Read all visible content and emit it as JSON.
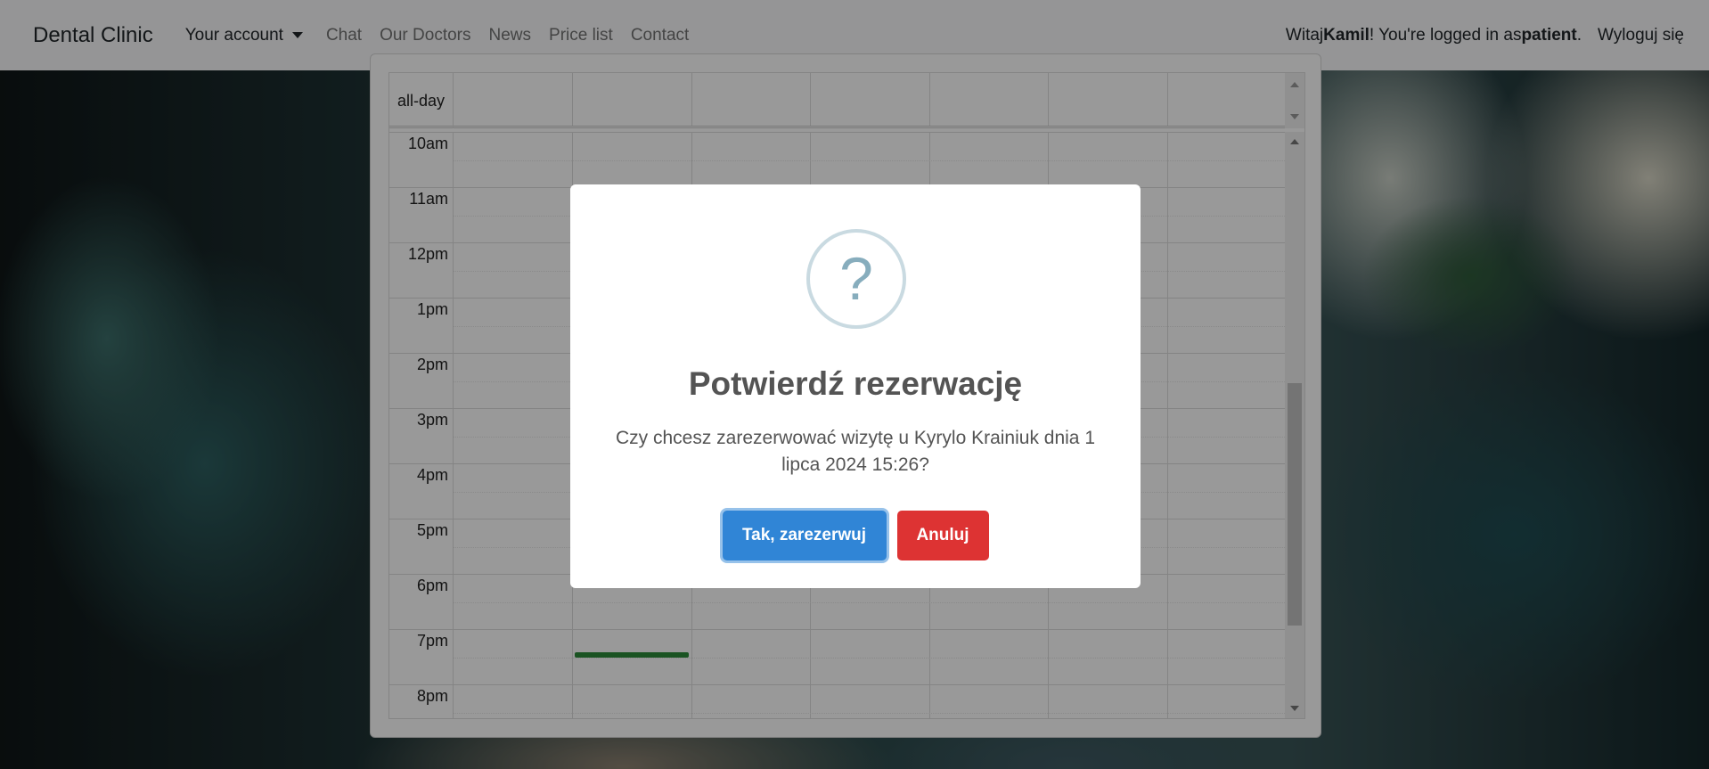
{
  "navbar": {
    "brand": "Dental Clinic",
    "account_menu": "Your account",
    "links": [
      "Chat",
      "Our Doctors",
      "News",
      "Price list",
      "Contact"
    ],
    "greeting_prefix": "Witaj ",
    "user_name": "Kamil",
    "greeting_mid": "! You're logged in as ",
    "role": "patient",
    "greeting_suffix": ".",
    "logout": "Wyloguj się"
  },
  "calendar": {
    "allday_label": "all-day",
    "hours": [
      "10am",
      "11am",
      "12pm",
      "1pm",
      "2pm",
      "3pm",
      "4pm",
      "5pm",
      "6pm",
      "7pm",
      "8pm"
    ]
  },
  "modal": {
    "icon": "question-icon",
    "icon_glyph": "?",
    "title": "Potwierdź rezerwację",
    "text": "Czy chcesz zarezerwować wizytę u Kyrylo Krainiuk dnia 1 lipca 2024 15:26?",
    "confirm_label": "Tak, zarezerwuj",
    "cancel_label": "Anuluj"
  },
  "colors": {
    "confirm": "#3085d6",
    "cancel": "#dd3333",
    "event": "#2c8a3a"
  }
}
